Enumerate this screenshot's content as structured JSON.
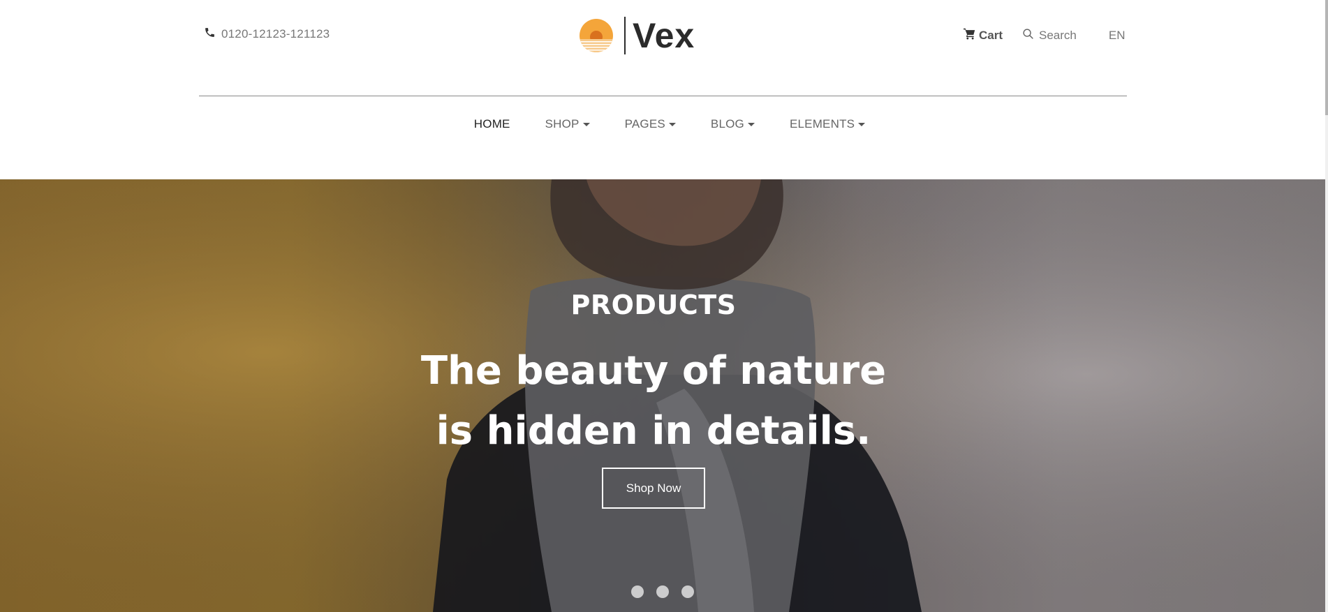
{
  "header": {
    "phone": "0120-12123-121123",
    "logo_text": "Vex",
    "cart_label": "Cart",
    "search_label": "Search",
    "language": "EN"
  },
  "nav": {
    "items": [
      {
        "label": "HOME",
        "dropdown": false,
        "active": true
      },
      {
        "label": "SHOP",
        "dropdown": true,
        "active": false
      },
      {
        "label": "PAGES",
        "dropdown": true,
        "active": false
      },
      {
        "label": "BLOG",
        "dropdown": true,
        "active": false
      },
      {
        "label": "ELEMENTS",
        "dropdown": true,
        "active": false
      }
    ]
  },
  "hero": {
    "eyebrow": "PRODUCTS",
    "headline_line1": "The beauty of nature",
    "headline_line2": "is hidden in details.",
    "button_label": "Shop Now",
    "slide_count": 3
  },
  "icons": [
    "phone-icon",
    "logo-sun-icon",
    "cart-icon",
    "search-icon",
    "chevron-down-icon"
  ],
  "colors": {
    "accent": "#f4a53a",
    "text_dark": "#2b2b2b",
    "text_muted": "#777777"
  }
}
